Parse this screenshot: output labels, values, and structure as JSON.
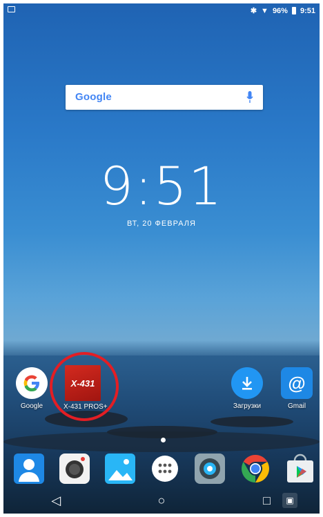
{
  "status_bar": {
    "battery": "96%",
    "time": "9:51"
  },
  "search": {
    "logo": "Google"
  },
  "clock": {
    "time": "9:51",
    "date": "ВТ, 20 ФЕВРАЛЯ"
  },
  "home_apps": [
    {
      "label": "Google",
      "icon": "google-icon"
    },
    {
      "label": "X-431 PROS+",
      "icon": "x431-icon",
      "logo_text": "X-431"
    },
    {
      "label": "Загрузки",
      "icon": "download-icon"
    },
    {
      "label": "Gmail",
      "icon": "email-icon",
      "glyph": "@"
    }
  ],
  "dock": [
    "contacts-icon",
    "camera-icon",
    "gallery-icon",
    "apps-drawer-icon",
    "settings-icon",
    "chrome-icon",
    "play-store-icon"
  ],
  "nav": {
    "back": "◁",
    "home": "○",
    "recents": "□"
  },
  "colors": {
    "highlight_ring": "#e31e24",
    "x431_red": "#c0231a"
  }
}
